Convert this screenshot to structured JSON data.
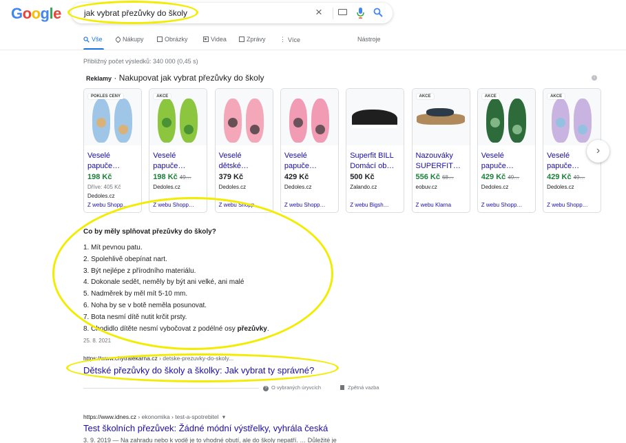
{
  "logo": {
    "letters": [
      "G",
      "o",
      "o",
      "g",
      "l",
      "e"
    ],
    "colors": [
      "#4285f4",
      "#ea4335",
      "#fbbc05",
      "#4285f4",
      "#34a853",
      "#ea4335"
    ]
  },
  "search": {
    "query": "jak vybrat přezůvky do školy",
    "clear_icon": "close-icon",
    "keyboard_icon": "keyboard-icon",
    "mic_icon": "microphone-icon",
    "search_icon": "search-icon"
  },
  "tabs": {
    "items": [
      {
        "label": "Vše",
        "icon": "search-icon"
      },
      {
        "label": "Nákupy",
        "icon": "tag-icon"
      },
      {
        "label": "Obrázky",
        "icon": "image-icon"
      },
      {
        "label": "Videa",
        "icon": "play-icon"
      },
      {
        "label": "Zprávy",
        "icon": "news-icon"
      },
      {
        "label": "Více",
        "icon": "more-vertical-icon"
      }
    ],
    "tools": "Nástroje"
  },
  "stats": "Přibližný počet výsledků: 340 000 (0,45 s)",
  "ads": {
    "label": "Reklamy",
    "separator": "·",
    "heading": "Nakupovat jak vybrat přezůvky do školy",
    "info_icon": "info-icon",
    "next_icon": "chevron-right-icon",
    "cards": [
      {
        "badge": "POKLES CENY",
        "title_line1": "Veselé",
        "title_line2": "papuče…",
        "price": "198 Kč",
        "old_price": "",
        "was": "Dříve: 405 Kč",
        "seller": "Dedoles.cz",
        "via": "Z webu Shopp…",
        "sale": true,
        "colors": [
          "#9fc6e6",
          "#f2a94a"
        ]
      },
      {
        "badge": "AKCE",
        "title_line1": "Veselé",
        "title_line2": "papuče…",
        "price": "198 Kč",
        "old_price": "49…",
        "was": "",
        "seller": "Dedoles.cz",
        "via": "Z webu Shopp…",
        "sale": true,
        "colors": [
          "#8cc63f",
          "#2e7d32"
        ]
      },
      {
        "badge": "",
        "title_line1": "Veselé",
        "title_line2": "dětské…",
        "price": "379 Kč",
        "old_price": "",
        "was": "",
        "seller": "Dedoles.cz",
        "via": "Z webu Shopp…",
        "sale": false,
        "colors": [
          "#f4a7b9",
          "#2b2b2b"
        ]
      },
      {
        "badge": "",
        "title_line1": "Veselé",
        "title_line2": "papuče…",
        "price": "429 Kč",
        "old_price": "",
        "was": "",
        "seller": "Dedoles.cz",
        "via": "Z webu Shopp…",
        "sale": false,
        "colors": [
          "#f29bb5",
          "#333333"
        ]
      },
      {
        "badge": "",
        "title_line1": "Superfit BILL",
        "title_line2": "Domácí ob…",
        "price": "500 Kč",
        "old_price": "",
        "was": "",
        "seller": "Zalando.cz",
        "via": "Z webu Bigsh…",
        "sale": false,
        "colors": [
          "#1f1f1f",
          "#ffffff"
        ]
      },
      {
        "badge": "AKCE",
        "title_line1": "Nazouváky",
        "title_line2": "SUPERFIT…",
        "price": "556 Kč",
        "old_price": "68…",
        "was": "",
        "seller": "eobuv.cz",
        "via": "Z webu Klarna",
        "sale": true,
        "colors": [
          "#b08a5a",
          "#2d3a4a"
        ]
      },
      {
        "badge": "AKCE",
        "title_line1": "Veselé",
        "title_line2": "papuče…",
        "price": "429 Kč",
        "old_price": "49…",
        "was": "",
        "seller": "Dedoles.cz",
        "via": "Z webu Shopp…",
        "sale": true,
        "colors": [
          "#2e6b3a",
          "#a5d6a7"
        ]
      },
      {
        "badge": "AKCE",
        "title_line1": "Veselé",
        "title_line2": "papuče…",
        "price": "429 Kč",
        "old_price": "49…",
        "was": "",
        "seller": "Dedoles.cz",
        "via": "Z webu Shopp…",
        "sale": true,
        "colors": [
          "#c9b3e0",
          "#7ec8e3"
        ]
      }
    ]
  },
  "snippet": {
    "question": "Co by měly splňovat přezůvky do školy?",
    "items": [
      "1. Mít pevnou patu.",
      "2. Spolehlivě obepínat nart.",
      "3. Být nejlépe z přírodního materiálu.",
      "4. Dokonale sedět, neměly by být ani velké, ani malé",
      "5. Nadměrek by měl mít 5-10 mm.",
      "6. Noha by se v botě neměla posunovat.",
      "7. Bota nesmí dítě nutit krčit prsty.",
      "8. Chodidlo dítěte nesmí vybočovat z podélné osy "
    ],
    "last_bold": "přezůvky",
    "last_end": ".",
    "date": "25. 8. 2021"
  },
  "result1": {
    "url": "https://www.chytralekarna.cz",
    "path": " › detske-prezuvky-do-skoly...",
    "title": "Dětské přezůvky do školy a školky: Jak vybrat ty správné?"
  },
  "feedback": {
    "about": "O vybraných úryvcích",
    "about_icon": "help-icon",
    "feedback": "Zpětná vazba",
    "feedback_icon": "flag-icon"
  },
  "result2": {
    "url": "https://www.idnes.cz",
    "path": " › ekonomika › test-a-spotrebitel",
    "menu_icon": "▾",
    "title": "Test školních přezůvek: Žádné módní výstřelky, vyhrála česká",
    "snippet": "3. 9. 2019 — Na zahradu nebo k vodě je to vhodné obutí, ale do školy nepatří. … Důležité je"
  },
  "highlight_color": "#f2ec00"
}
